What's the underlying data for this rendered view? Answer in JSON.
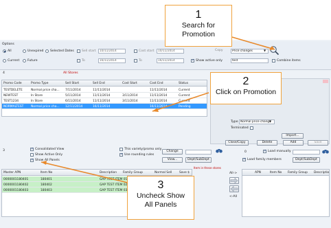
{
  "options": {
    "title": "Options",
    "status_radios": [
      "All",
      "Unexpired",
      "Selected Dates",
      "Current",
      "Future"
    ],
    "sell_start_label": "Sell start",
    "sell_start_date": "10/11/2014",
    "to_label": "To",
    "sell_to_date": "16/11/2014",
    "cost_start_label": "Cost start",
    "cost_start_date": "10/11/2014",
    "cost_to_date": "16/11/2014",
    "copy_label": "Copy",
    "type_value": "Price changes",
    "show_active_only": "Show active only",
    "search_value": "test",
    "combine_items": "Combine items"
  },
  "list_header": {
    "count": "4",
    "store": "All Stores"
  },
  "promo_columns": [
    "Promo Code",
    "Promo Type",
    "Sell Start",
    "Sell End",
    "Cost Start",
    "Cost End",
    "Status"
  ],
  "promos": [
    {
      "code": "TESTDELETE",
      "type": "Normal price cha...",
      "sell_start": "7/11/2014",
      "sell_end": "11/11/2014",
      "cost_start": "",
      "cost_end": "11/11/2014",
      "status": "Current"
    },
    {
      "code": "NEWTEST",
      "type": "In Store",
      "sell_start": "5/11/2014",
      "sell_end": "11/11/2014",
      "cost_start": "3/11/2014",
      "cost_end": "11/11/2014",
      "status": "Current"
    },
    {
      "code": "TEST1234",
      "type": "In Store",
      "sell_start": "6/11/2014",
      "sell_end": "11/11/2014",
      "cost_start": "3/11/2014",
      "cost_end": "11/11/2014",
      "status": "Current"
    },
    {
      "code": "NORMALTEST",
      "type": "Normal price cha...",
      "sell_start": "12/11/2014",
      "sell_end": "16/11/2014",
      "cost_start": "",
      "cost_end": "16/11/2014",
      "status": "Pending"
    }
  ],
  "detail": {
    "type_label": "Type",
    "type_value": "Normal price change",
    "terminated_label": "Terminated",
    "import_label": "Import...",
    "close_copy": "Close/Copy",
    "delete_label": "Delete",
    "add_label": "Add",
    "save_label": "Save"
  },
  "items_panel": {
    "count": "3",
    "consolidated_view": "Consolidated View",
    "show_active_only": "Show Active Only",
    "show_all_panels": "Show All Panels",
    "variety_only": "This variety/promo only",
    "use_rounding": "Use rounding rules",
    "change_label": "Change",
    "view_label": "View...",
    "dept_label": "Dept/SubDept",
    "items_in_stores": "Item in these stores",
    "columns": [
      "Master APN",
      "Item No",
      "Description",
      "Family Group",
      "Normal Sell",
      "Save $"
    ],
    "rows": [
      {
        "apn": "0000001180401",
        "item": "180401",
        "desc": "GAP TEST ITEM 01"
      },
      {
        "apn": "0000001180402",
        "item": "180402",
        "desc": "GAP TEST ITEM 02"
      },
      {
        "apn": "0000001180403",
        "item": "180403",
        "desc": "GAP TEST ITEM 03"
      }
    ]
  },
  "nav_buttons": {
    "all_right": "All->",
    "right": "->",
    "left": "<-",
    "all_left": "<-All"
  },
  "right_panel": {
    "count": "0",
    "load_manually": "Load manually",
    "load_family": "Load family members",
    "dept_label": "Dept/SubDept",
    "columns": [
      "APN",
      "Item No",
      "Family Group",
      "Descriptio"
    ]
  },
  "callouts": [
    {
      "num": "1",
      "text": "Search for Promotion"
    },
    {
      "num": "2",
      "text": "Click on Promotion"
    },
    {
      "num": "3",
      "text": "Uncheck Show All Panels"
    }
  ],
  "colors": {
    "callout_border": "#f0a23c",
    "arrow": "#e8892b",
    "selection": "#3399ff",
    "green_row": "#c7f0c7",
    "red_text": "#c00000"
  }
}
